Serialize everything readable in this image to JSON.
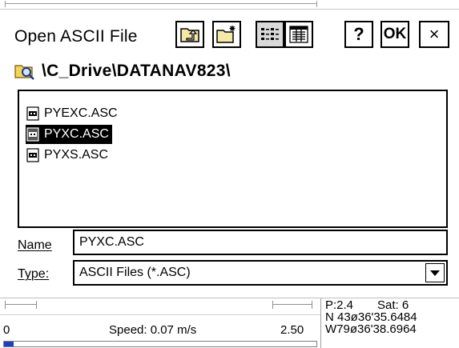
{
  "dialog": {
    "title": "Open ASCII File",
    "toolbar": {
      "help_label": "?",
      "ok_label": "OK",
      "close_label": "×"
    },
    "path": "\\C_Drive\\DATANAV823\\",
    "files": [
      {
        "name": "PYEXC.ASC",
        "selected": false
      },
      {
        "name": "PYXC.ASC",
        "selected": true
      },
      {
        "name": "PYXS.ASC",
        "selected": false
      }
    ],
    "name_label": "Name",
    "name_value": "PYXC.ASC",
    "type_label": "Type:",
    "type_value": "ASCII Files (*.ASC)"
  },
  "status": {
    "left_value": "0",
    "speed": "Speed: 0.07 m/s",
    "right_value": "2.50",
    "precision": "P:2.4",
    "satellites": "Sat: 6",
    "latitude": "N 43ø36'35.6484",
    "longitude": "W79ø36'38.6964",
    "progress_fraction": 0.03
  },
  "colors": {
    "accent": "#1f3fbf",
    "selection_bg": "#000000",
    "selection_fg": "#ffffff"
  },
  "icons": {
    "up": "folder-up-icon",
    "new_folder": "new-folder-icon",
    "list": "list-view-icon",
    "details": "details-view-icon",
    "path": "folder-search-icon",
    "file": "ascii-file-icon",
    "dropdown": "chevron-down-icon"
  }
}
